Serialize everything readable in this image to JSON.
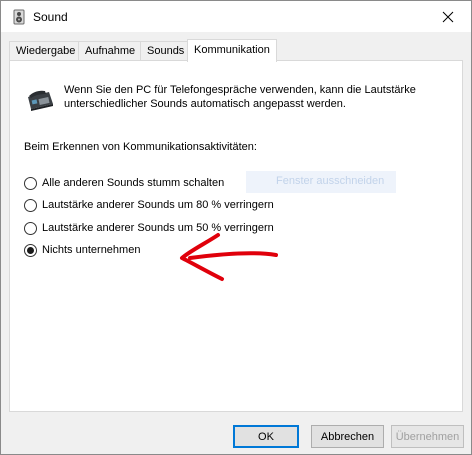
{
  "window": {
    "title": "Sound",
    "close_icon": "close-icon"
  },
  "tabs": [
    {
      "label": "Wiedergabe",
      "active": false
    },
    {
      "label": "Aufnahme",
      "active": false
    },
    {
      "label": "Sounds",
      "active": false
    },
    {
      "label": "Kommunikation",
      "active": true
    }
  ],
  "panel": {
    "intro_icon": "telephone-icon",
    "intro_text": "Wenn Sie den PC für Telefongespräche verwenden, kann die Lautstärke unterschiedlicher Sounds automatisch angepasst werden.",
    "section_label": "Beim Erkennen von Kommunikationsaktivitäten:",
    "options": [
      {
        "label": "Alle anderen Sounds stumm schalten",
        "selected": false
      },
      {
        "label": "Lautstärke anderer Sounds um 80 % verringern",
        "selected": false
      },
      {
        "label": "Lautstärke anderer Sounds um 50 % verringern",
        "selected": false
      },
      {
        "label": "Nichts unternehmen",
        "selected": true
      }
    ],
    "ghost_text": "Fenster ausschneiden",
    "annotation": {
      "icon": "red-arrow-annotation",
      "color": "#e0000b"
    }
  },
  "buttons": {
    "ok": "OK",
    "cancel": "Abbrechen",
    "apply": "Übernehmen"
  },
  "colors": {
    "accent": "#0078d7",
    "annotation": "#e0000b"
  }
}
